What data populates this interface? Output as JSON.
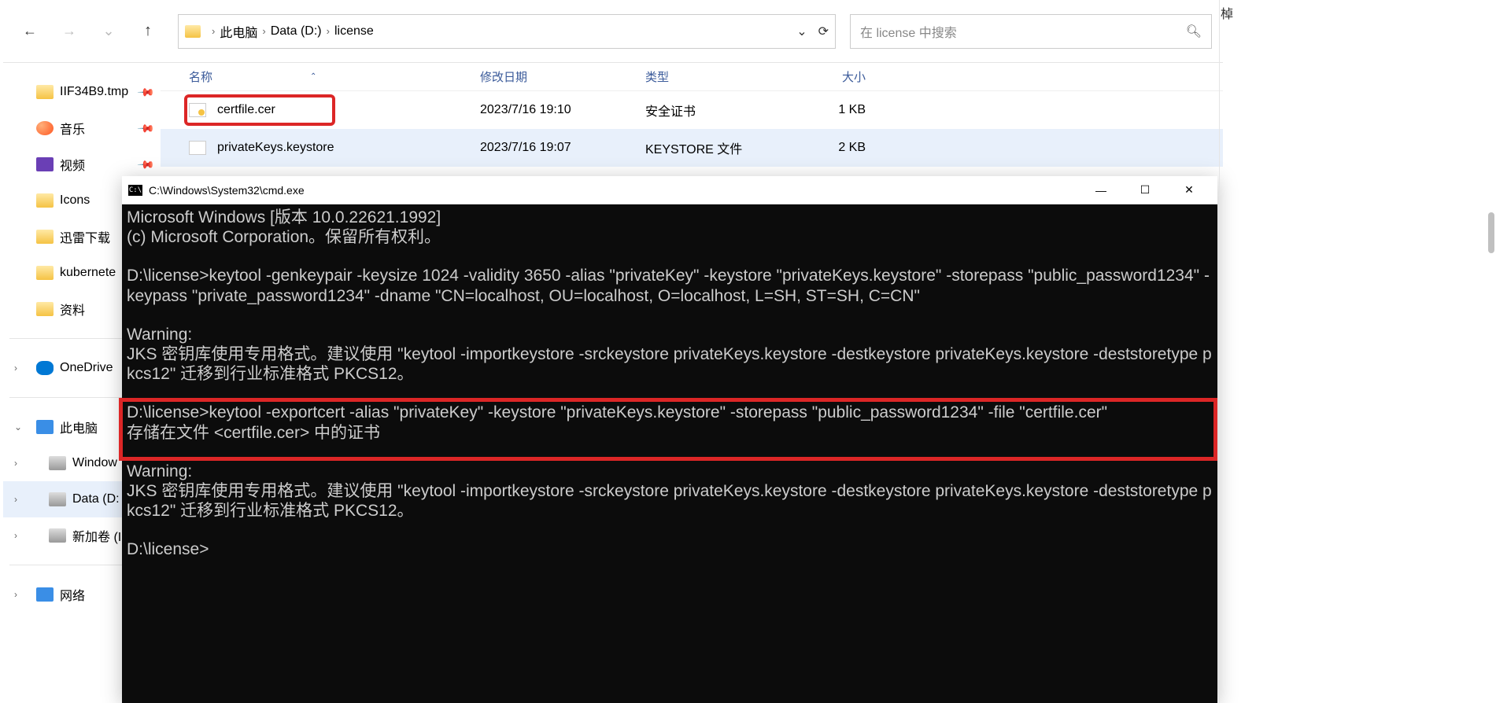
{
  "breadcrumb": {
    "root": "此电脑",
    "drive": "Data (D:)",
    "folder": "license"
  },
  "search": {
    "placeholder": "在 license 中搜索"
  },
  "sidebar": {
    "items": [
      {
        "label": "IIF34B9.tmp"
      },
      {
        "label": "音乐"
      },
      {
        "label": "视频"
      },
      {
        "label": "Icons"
      },
      {
        "label": "迅雷下载"
      },
      {
        "label": "kubernete"
      },
      {
        "label": "资料"
      }
    ],
    "onedrive": "OneDrive",
    "thispc": "此电脑",
    "drives": [
      {
        "label": "Window"
      },
      {
        "label": "Data (D:"
      },
      {
        "label": "新加卷 (I"
      }
    ],
    "network": "网络"
  },
  "columns": {
    "name": "名称",
    "date": "修改日期",
    "type": "类型",
    "size": "大小"
  },
  "files": [
    {
      "name": "certfile.cer",
      "date": "2023/7/16 19:10",
      "type": "安全证书",
      "size": "1 KB"
    },
    {
      "name": "privateKeys.keystore",
      "date": "2023/7/16 19:07",
      "type": "KEYSTORE 文件",
      "size": "2 KB"
    }
  ],
  "cmd": {
    "title": "C:\\Windows\\System32\\cmd.exe",
    "line1": "Microsoft Windows [版本 10.0.22621.1992]",
    "line2": "(c) Microsoft Corporation。保留所有权利。",
    "line3": "D:\\license>keytool -genkeypair -keysize 1024 -validity 3650 -alias \"privateKey\" -keystore \"privateKeys.keystore\" -storepass \"public_password1234\" -keypass \"private_password1234\" -dname \"CN=localhost, OU=localhost, O=localhost, L=SH, ST=SH, C=CN\"",
    "line4": "Warning:",
    "line5": "JKS 密钥库使用专用格式。建议使用 \"keytool -importkeystore -srckeystore privateKeys.keystore -destkeystore privateKeys.keystore -deststoretype pkcs12\" 迁移到行业标准格式 PKCS12。",
    "line6": "D:\\license>keytool -exportcert -alias \"privateKey\" -keystore \"privateKeys.keystore\" -storepass \"public_password1234\" -file \"certfile.cer\"",
    "line7": "存储在文件 <certfile.cer> 中的证书",
    "line8": "Warning:",
    "line9": "JKS 密钥库使用专用格式。建议使用 \"keytool -importkeystore -srckeystore privateKeys.keystore -destkeystore privateKeys.keystore -deststoretype pkcs12\" 迁移到行业标准格式 PKCS12。",
    "line10": "D:\\license>"
  },
  "corner": "棹"
}
